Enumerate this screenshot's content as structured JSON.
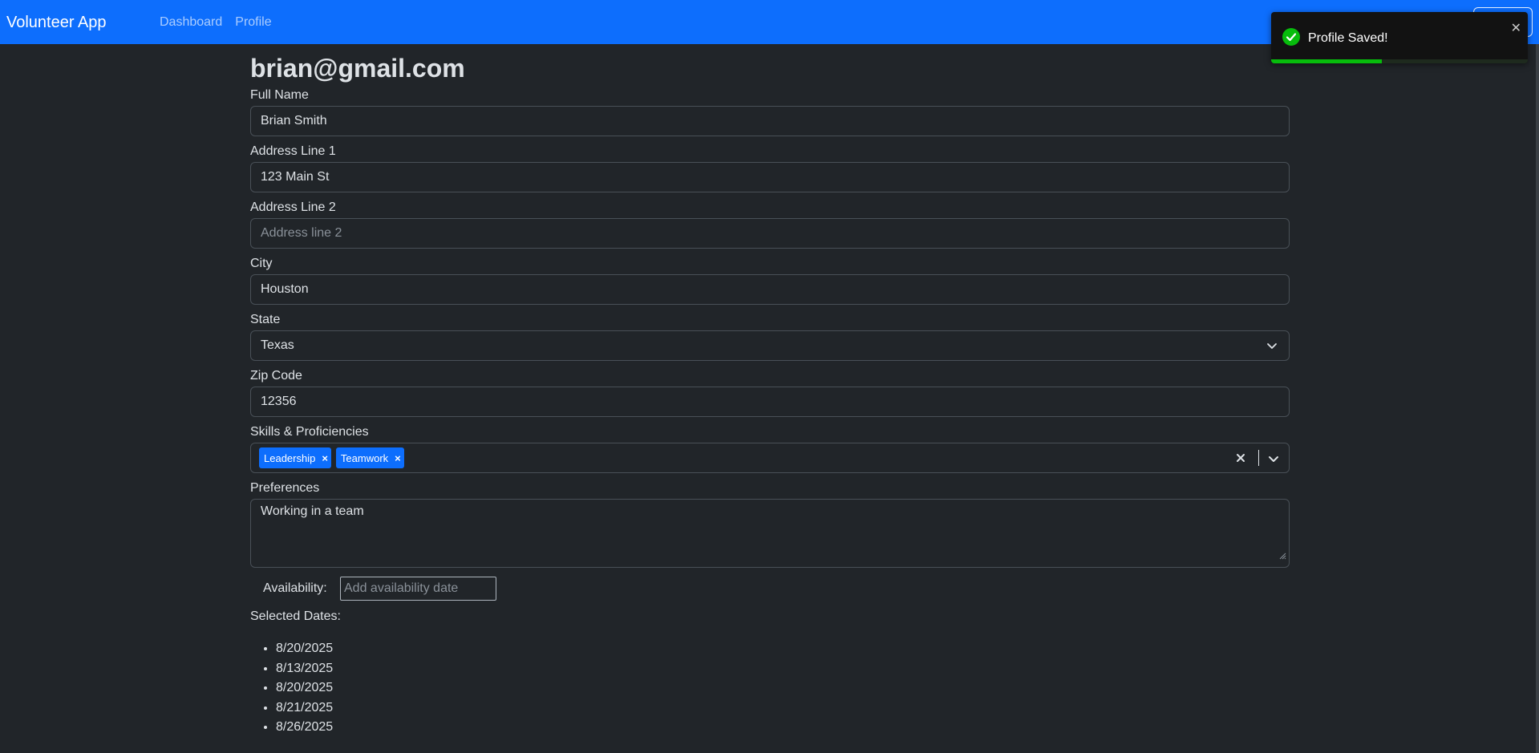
{
  "navbar": {
    "brand": "Volunteer App",
    "links": [
      "Dashboard",
      "Profile"
    ],
    "bg_color": "#0d6efd"
  },
  "profile": {
    "email": "brian@gmail.com",
    "full_name": {
      "label": "Full Name",
      "value": "Brian Smith"
    },
    "address1": {
      "label": "Address Line 1",
      "value": "123 Main St"
    },
    "address2": {
      "label": "Address Line 2",
      "value": "",
      "placeholder": "Address line 2"
    },
    "city": {
      "label": "City",
      "value": "Houston"
    },
    "state": {
      "label": "State",
      "value": "Texas"
    },
    "zip": {
      "label": "Zip Code",
      "value": "12356"
    },
    "skills": {
      "label": "Skills & Proficiencies",
      "tags": [
        "Leadership",
        "Teamwork"
      ]
    },
    "preferences": {
      "label": "Preferences",
      "value": "Working in a team"
    },
    "availability": {
      "label": "Availability:",
      "placeholder": "Add availability date"
    },
    "selected_dates": {
      "label": "Selected Dates:",
      "dates": [
        "8/20/2025",
        "8/13/2025",
        "8/20/2025",
        "8/21/2025",
        "8/26/2025"
      ]
    }
  },
  "toast": {
    "message": "Profile Saved!",
    "close_glyph": "✕",
    "progress_fraction": 0.43,
    "success_color": "#07bc0c"
  }
}
